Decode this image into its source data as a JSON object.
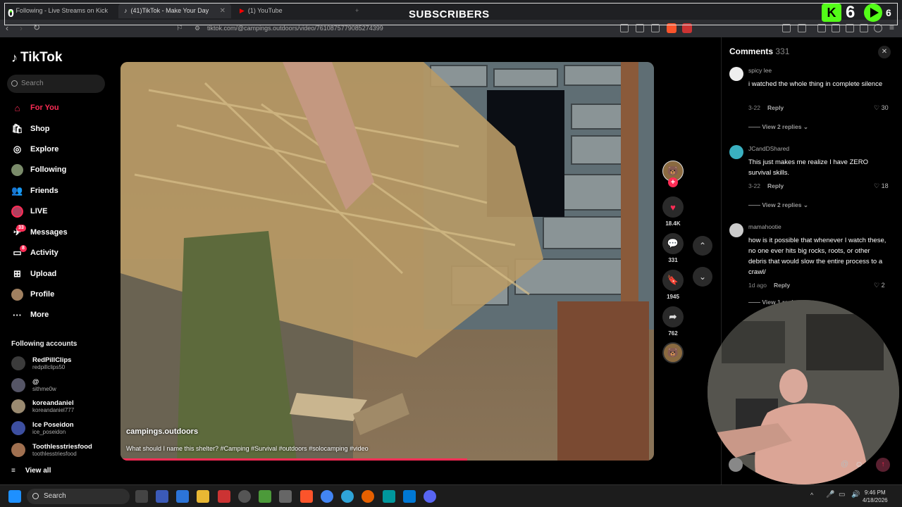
{
  "browser": {
    "tabs": [
      {
        "label": "Following - Live Streams on Kick",
        "active": false
      },
      {
        "label": "(41)TikTok - Make Your Day",
        "active": true
      },
      {
        "label": "(1) YouTube",
        "active": false
      }
    ],
    "url": "tiktok.com/@campings.outdoors/video/7610875779085274399"
  },
  "overlay": {
    "left_count": "0",
    "subscribers_label": "SUBSCRIBERS",
    "kick_count": "6",
    "youtube_count": "6",
    "kick_letter": "K"
  },
  "sidebar": {
    "logo": "TikTok",
    "search_placeholder": "Search",
    "nav": [
      {
        "label": "For You",
        "icon": "home-icon",
        "active": true
      },
      {
        "label": "Shop",
        "icon": "shop-icon",
        "active": false
      },
      {
        "label": "Explore",
        "icon": "compass-icon",
        "active": false
      },
      {
        "label": "Following",
        "icon": "following-avatar-icon",
        "active": false
      },
      {
        "label": "Friends",
        "icon": "friends-icon",
        "active": false
      },
      {
        "label": "LIVE",
        "icon": "live-icon",
        "active": false
      },
      {
        "label": "Messages",
        "icon": "messages-icon",
        "active": false,
        "badge": "33"
      },
      {
        "label": "Activity",
        "icon": "activity-icon",
        "active": false,
        "badge": "8"
      },
      {
        "label": "Upload",
        "icon": "upload-icon",
        "active": false
      },
      {
        "label": "Profile",
        "icon": "profile-icon",
        "active": false
      },
      {
        "label": "More",
        "icon": "more-icon",
        "active": false
      }
    ],
    "following_title": "Following accounts",
    "accounts": [
      {
        "name": "RedPillClips",
        "handle": "redpillclips50",
        "color": "#3b3b3b"
      },
      {
        "name": "@",
        "handle": "sithme0w",
        "color": "#556"
      },
      {
        "name": "koreandaniel",
        "handle": "koreandaniel777",
        "color": "#9a8a70"
      },
      {
        "name": "Ice Poseidon",
        "handle": "ice_poseidon",
        "color": "#3d4fa0"
      },
      {
        "name": "Toothlesstriesfood",
        "handle": "toothlesstriesfood",
        "color": "#a07050"
      }
    ],
    "view_all": "View all"
  },
  "video": {
    "author": "campings.outdoors",
    "caption": "What should I name this shelter? #Camping #Survival #outdoors #solocamping #video",
    "progress": 0.65
  },
  "actions": {
    "likes": "18.4K",
    "comments": "331",
    "saves": "1945",
    "shares": "762"
  },
  "comments_panel": {
    "title": "Comments",
    "count": "331",
    "comments": [
      {
        "user": "spicy lee",
        "text": "i watched the whole thing in complete silence",
        "date": "3-22",
        "reply": "Reply",
        "likes": "30",
        "replies": "View 2 replies"
      },
      {
        "user": "JCandDShared",
        "text": "This just makes me realize I have ZERO survival skills.",
        "date": "3-22",
        "reply": "Reply",
        "likes": "18",
        "replies": "View 2 replies"
      },
      {
        "user": "mamahootie",
        "text": "how is it possible that whenever I watch these, no one ever hits big rocks, roots, or other debris that would slow the entire process to a crawl/",
        "date": "1d ago",
        "reply": "Reply",
        "likes": "2",
        "replies": "View 1 reply"
      }
    ]
  },
  "taskbar": {
    "search": "Search",
    "time": "9:46 PM",
    "date": "4/18/2026"
  },
  "colors": {
    "accent": "#fe2c55",
    "kick_green": "#53fc18"
  }
}
